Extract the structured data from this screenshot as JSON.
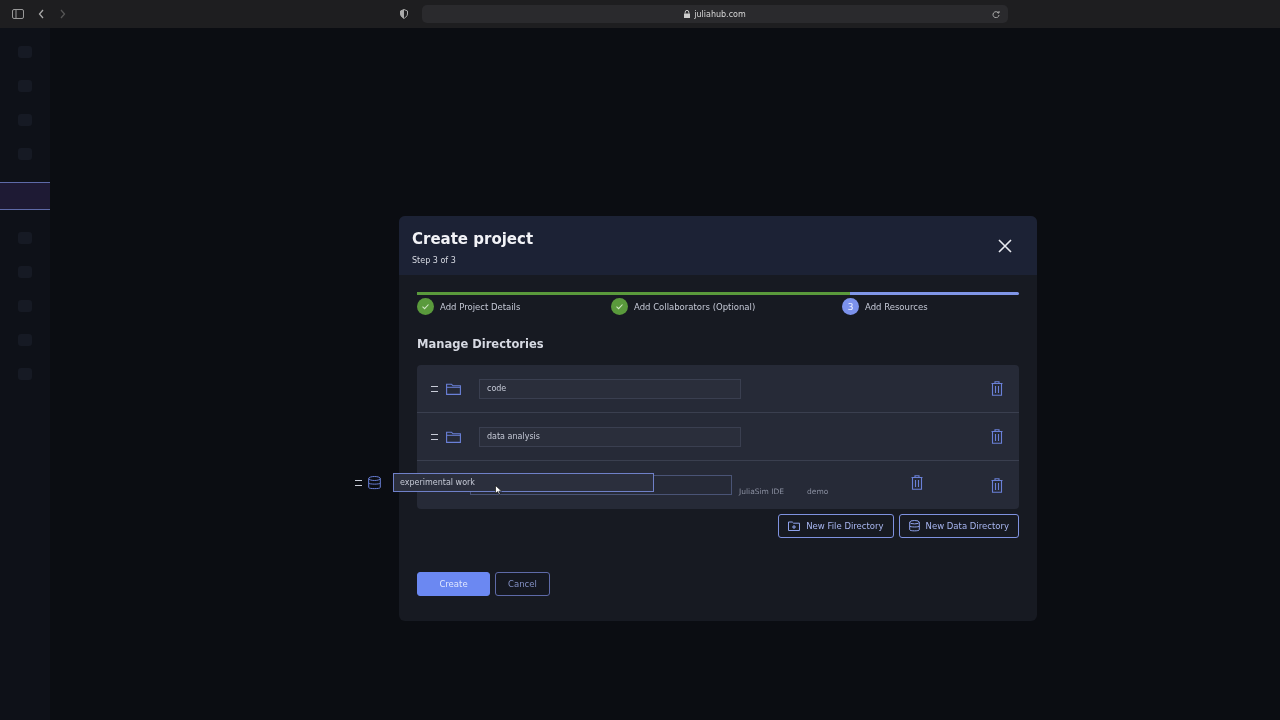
{
  "browser": {
    "url": "juliahub.com"
  },
  "dialog": {
    "title": "Create project",
    "subtitle": "Step 3 of 3",
    "progress": {
      "level": 0.72
    },
    "steps": [
      {
        "label": "Add Project Details",
        "completed": true
      },
      {
        "label": "Add Collaborators (Optional)",
        "completed": true
      },
      {
        "label": "Add Resources",
        "completed": false,
        "number": "3"
      }
    ],
    "section_title": "Manage Directories",
    "directories": [
      {
        "kind": "folder",
        "name": "code"
      },
      {
        "kind": "folder",
        "name": "data analysis"
      }
    ],
    "drop_slot": {
      "ghost_texts": [
        "JuliaSim IDE",
        "demo"
      ]
    },
    "dragged": {
      "kind": "data",
      "name": "experimental work"
    },
    "add_buttons": [
      {
        "kind": "folder",
        "label": "New File Directory"
      },
      {
        "kind": "data",
        "label": "New Data Directory"
      }
    ],
    "actions": [
      {
        "label": "Create",
        "primary": true
      },
      {
        "label": "Cancel",
        "primary": false
      }
    ]
  }
}
